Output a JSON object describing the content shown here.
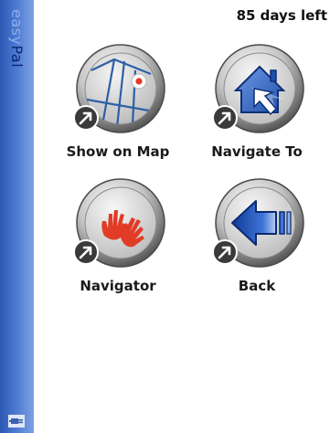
{
  "app": {
    "brand_prefix": "easy",
    "brand_suffix": "Pal"
  },
  "status": {
    "days_left": "85 days left"
  },
  "tiles": [
    {
      "label": "Show on Map",
      "icon": "map-icon"
    },
    {
      "label": "Navigate To",
      "icon": "house-arrow-icon"
    },
    {
      "label": "Navigator",
      "icon": "hands-icon"
    },
    {
      "label": "Back",
      "icon": "back-arrow-icon"
    }
  ],
  "colors": {
    "sidebar_blue": "#2c57b3",
    "accent_red": "#e23b26",
    "icon_blue": "#1f55b8"
  }
}
